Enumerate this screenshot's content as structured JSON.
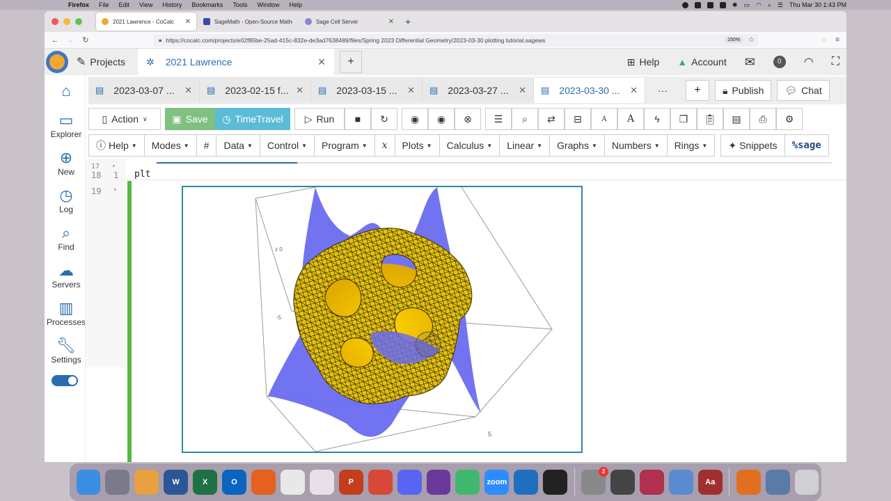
{
  "menubar": {
    "app": "Firefox",
    "items": [
      "File",
      "Edit",
      "View",
      "History",
      "Bookmarks",
      "Tools",
      "Window",
      "Help"
    ],
    "clock": "Thu Mar 30  1:43 PM"
  },
  "browser": {
    "tabs": [
      {
        "label": "2021 Lawrence - CoCalc",
        "color": "#f0a830"
      },
      {
        "label": "SageMath - Open-Source Mathe",
        "color": "#3a4aa8"
      },
      {
        "label": "Sage Cell Server",
        "color": "#8888cc"
      }
    ],
    "url": "https://cocalc.com/projects/e02f85be-25ad-415c-832e-de3ad7638489/files/Spring 2023 Differential Geometry/2023-03-30 plotting tutorial.sagews",
    "zoom": "150%"
  },
  "cocalc": {
    "projects_label": "Projects",
    "project_tab": "2021 Lawrence",
    "help": "Help",
    "account": "Account",
    "notifications": "0"
  },
  "sidebar": [
    {
      "label": "",
      "icon": "home-icon"
    },
    {
      "label": "Explorer",
      "icon": "folder-icon"
    },
    {
      "label": "New",
      "icon": "plus-circle-icon"
    },
    {
      "label": "Log",
      "icon": "history-icon"
    },
    {
      "label": "Find",
      "icon": "search-icon"
    },
    {
      "label": "Servers",
      "icon": "servers-icon"
    },
    {
      "label": "Processes",
      "icon": "processes-icon"
    },
    {
      "label": "Settings",
      "icon": "wrench-icon"
    }
  ],
  "file_tabs": [
    {
      "label": "2023-03-07 ..."
    },
    {
      "label": "2023-02-15 f..."
    },
    {
      "label": "2023-03-15 ..."
    },
    {
      "label": "2023-03-27 ..."
    },
    {
      "label": "2023-03-30 ..."
    }
  ],
  "file_actions": {
    "more": "···",
    "publish": "Publish",
    "chat": "Chat"
  },
  "toolbar": {
    "action": "Action",
    "save": "Save",
    "timetravel": "TimeTravel",
    "run": "Run"
  },
  "menus": [
    "Help",
    "Modes",
    "#",
    "Data",
    "Control",
    "Program",
    "x",
    "Plots",
    "Calculus",
    "Linear",
    "Graphs",
    "Numbers",
    "Rings"
  ],
  "snippets": "Snippets",
  "mode": "%sage",
  "worksheet": {
    "line_numbers": [
      {
        "n": "17",
        "f": "▾"
      },
      {
        "n": "18",
        "f": "1"
      },
      {
        "n": "19",
        "f": "▾"
      }
    ],
    "code": "plt",
    "progress": 0.208,
    "plot_axis_labels": [
      "z 0",
      "-5",
      "5"
    ]
  },
  "dock": [
    {
      "name": "finder",
      "color": "#3c8ee0",
      "text": ""
    },
    {
      "name": "launchpad",
      "color": "#7a7a8a",
      "text": ""
    },
    {
      "name": "photos",
      "color": "#e8a040",
      "text": ""
    },
    {
      "name": "word",
      "color": "#2b5797",
      "text": "W"
    },
    {
      "name": "excel",
      "color": "#1e7145",
      "text": "X"
    },
    {
      "name": "outlook",
      "color": "#0a64c0",
      "text": "O"
    },
    {
      "name": "firefox",
      "color": "#e66020",
      "text": ""
    },
    {
      "name": "textedit",
      "color": "#e8e8e8",
      "text": ""
    },
    {
      "name": "slack",
      "color": "#e8e0e8",
      "text": ""
    },
    {
      "name": "powerpoint",
      "color": "#c43e1c",
      "text": "P"
    },
    {
      "name": "chrome",
      "color": "#d84838",
      "text": ""
    },
    {
      "name": "discord",
      "color": "#5865f2",
      "text": ""
    },
    {
      "name": "github",
      "color": "#6a3a9a",
      "text": ""
    },
    {
      "name": "atom",
      "color": "#40b870",
      "text": ""
    },
    {
      "name": "zoom",
      "color": "#2d8cff",
      "text": "zoom"
    },
    {
      "name": "vscode",
      "color": "#1f6fc0",
      "text": ""
    },
    {
      "name": "activity",
      "color": "#222",
      "text": ""
    },
    {
      "name": "system-preferences",
      "color": "#888",
      "text": "",
      "badge": "2"
    },
    {
      "name": "quicktime",
      "color": "#444",
      "text": ""
    },
    {
      "name": "app-misc",
      "color": "#b03050",
      "text": ""
    },
    {
      "name": "preview",
      "color": "#5a8ad0",
      "text": ""
    },
    {
      "name": "dictionary",
      "color": "#a03030",
      "text": "Aa"
    },
    {
      "name": "potion",
      "color": "#e07020",
      "text": ""
    },
    {
      "name": "documents",
      "color": "#5a7aa8",
      "text": ""
    },
    {
      "name": "trash",
      "color": "#cfcfd4",
      "text": ""
    }
  ]
}
